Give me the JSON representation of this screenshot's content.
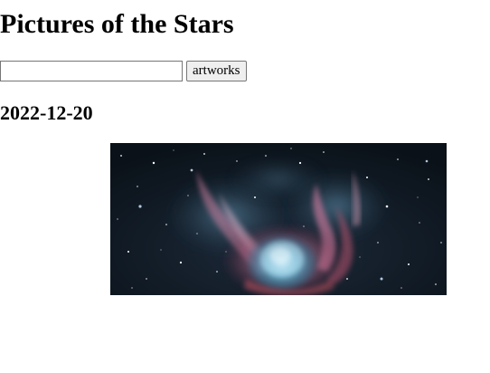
{
  "page": {
    "title": "Pictures of the Stars"
  },
  "search": {
    "value": "",
    "placeholder": "",
    "button_label": "artworks"
  },
  "result": {
    "date": "2022-12-20"
  }
}
